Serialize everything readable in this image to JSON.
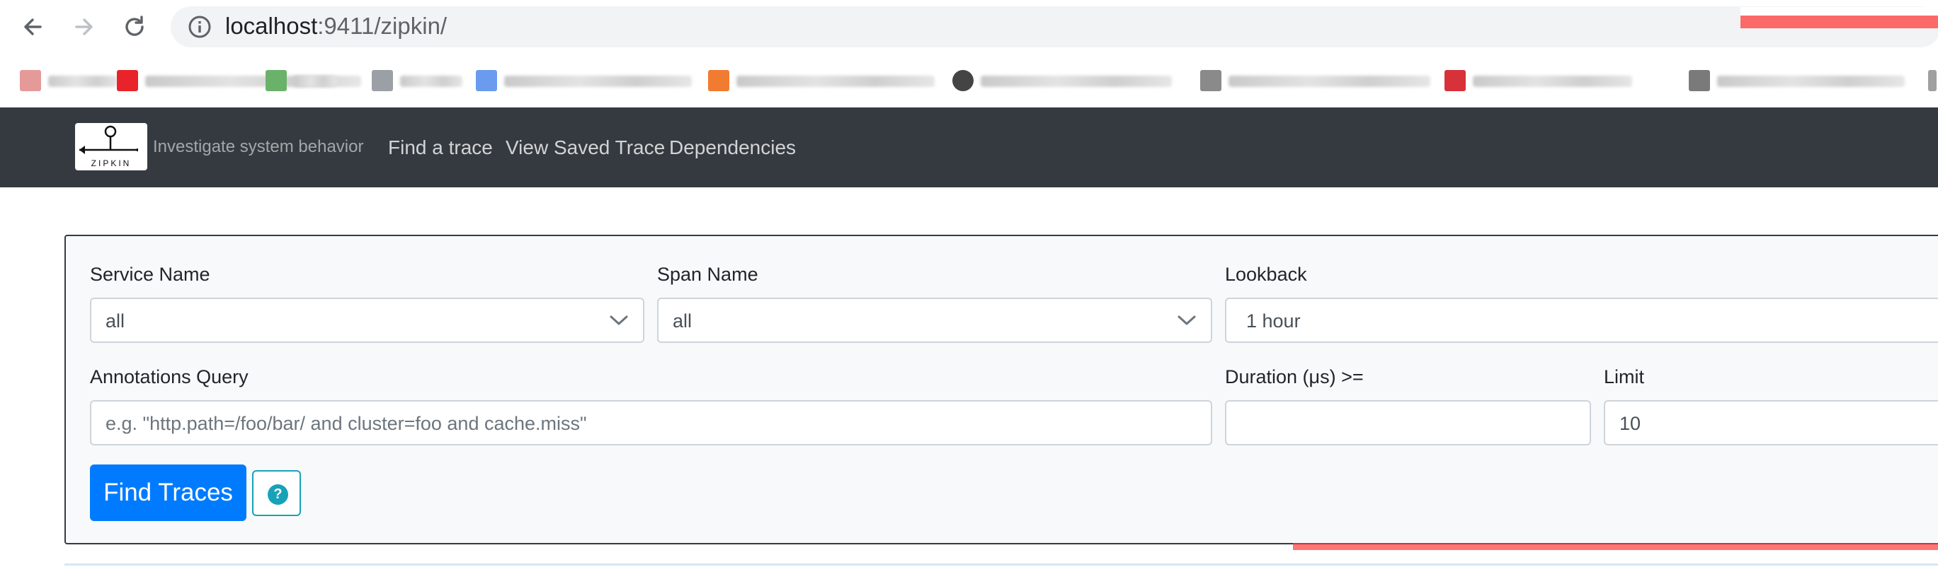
{
  "browser": {
    "url_host": "localhost",
    "url_rest": ":9411/zipkin/",
    "icons": [
      "back-arrow-icon",
      "forward-arrow-icon",
      "reload-icon",
      "info-icon"
    ]
  },
  "bookmark_favicon_colors": [
    "#e59a9a",
    "#e8232a",
    "#6ab26a",
    "#9aa0a6",
    "#4d8fe0",
    "#6b9bef",
    "#f27b32",
    "#444444",
    "#8a8a8a",
    "#d7323a",
    "#7a7a7a"
  ],
  "navbar": {
    "tagline": "Investigate system behavior",
    "links": [
      "Find a trace",
      "View Saved Trace",
      "Dependencies"
    ],
    "background": "#343a40"
  },
  "search": {
    "service_name_label": "Service Name",
    "service_name_value": "all",
    "span_name_label": "Span Name",
    "span_name_value": "all",
    "lookback_label": "Lookback",
    "lookback_value": "1 hour",
    "annotations_label": "Annotations Query",
    "annotations_placeholder": "e.g. \"http.path=/foo/bar/ and cluster=foo and cache.miss\"",
    "duration_label": "Duration (μs) >=",
    "duration_value": "",
    "limit_label": "Limit",
    "limit_value": "10",
    "find_button": "Find Traces",
    "help_icon": "question-circle-icon",
    "accent": "#007bff",
    "help_color": "#17a2b8"
  }
}
